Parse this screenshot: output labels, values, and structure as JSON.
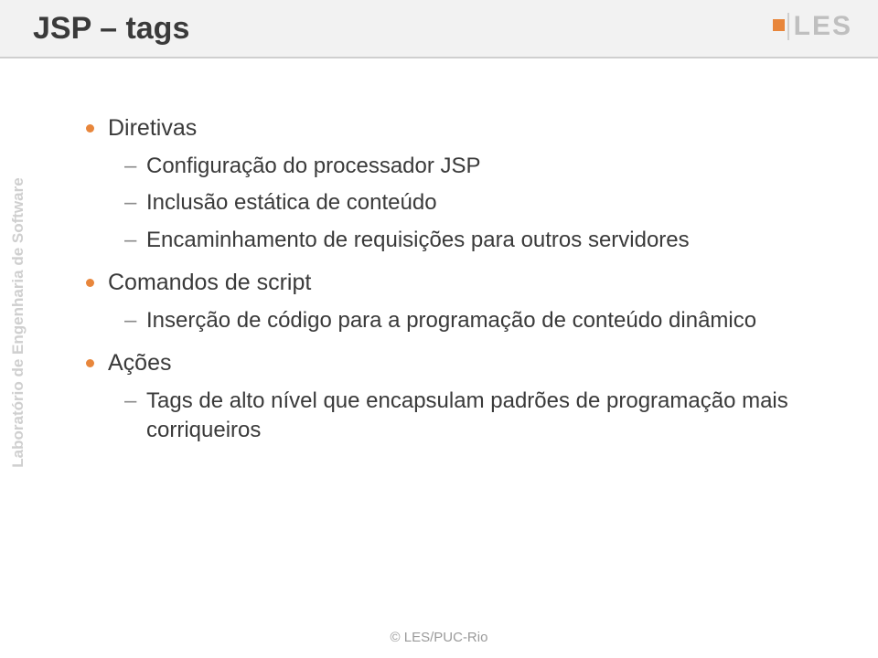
{
  "title": "JSP – tags",
  "logo": "LES",
  "sideband": "Laboratório de Engenharia de Software",
  "topics": [
    {
      "label": "Diretivas",
      "subs": [
        "Configuração do processador JSP",
        "Inclusão estática de conteúdo",
        "Encaminhamento de requisições para outros servidores"
      ]
    },
    {
      "label": "Comandos de script",
      "subs": [
        "Inserção de código para a programação de conteúdo dinâmico"
      ]
    },
    {
      "label": "Ações",
      "subs": [
        "Tags de alto nível que encapsulam padrões de programação mais corriqueiros"
      ]
    }
  ],
  "footer": "© LES/PUC-Rio"
}
